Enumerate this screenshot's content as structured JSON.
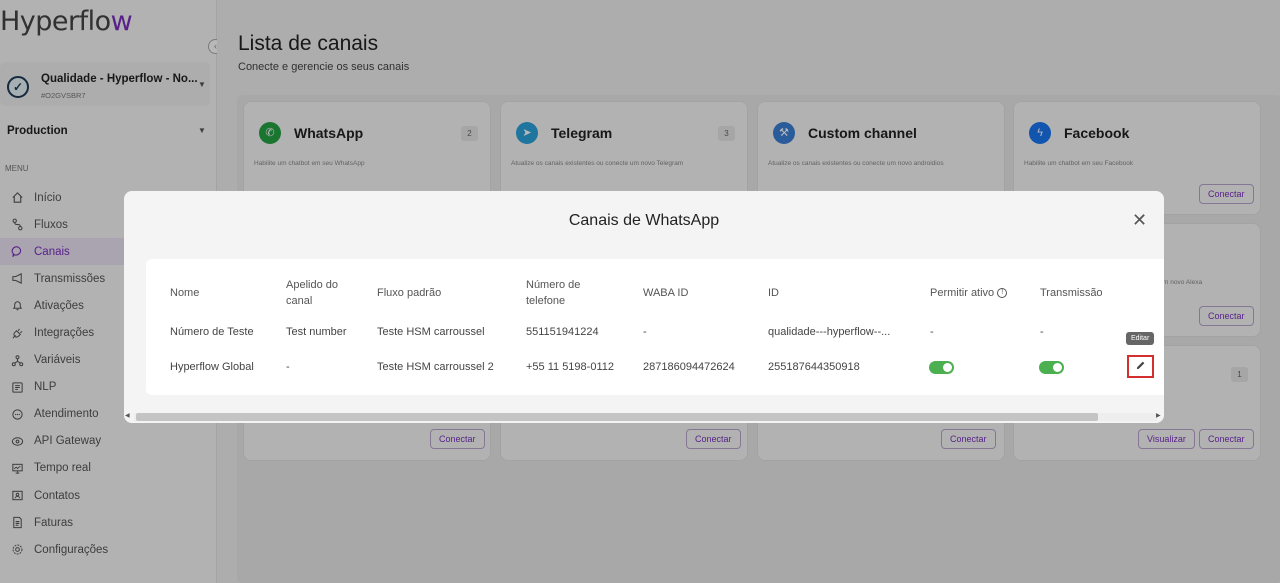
{
  "app": {
    "logo_text": "Hyperflow"
  },
  "sidebar": {
    "org_name": "Qualidade - Hyperflow - No...",
    "org_id": "#O2GVSBR7",
    "environment": "Production",
    "menu_header": "MENU",
    "items": [
      {
        "label": "Início",
        "icon": "home-icon"
      },
      {
        "label": "Fluxos",
        "icon": "flow-icon"
      },
      {
        "label": "Canais",
        "icon": "chat-icon",
        "active": true
      },
      {
        "label": "Transmissões",
        "icon": "megaphone-icon"
      },
      {
        "label": "Ativações",
        "icon": "bell-icon"
      },
      {
        "label": "Integrações",
        "icon": "plug-icon"
      },
      {
        "label": "Variáveis",
        "icon": "variables-icon"
      },
      {
        "label": "NLP",
        "icon": "nlp-icon"
      },
      {
        "label": "Atendimento",
        "icon": "support-icon"
      },
      {
        "label": "API Gateway",
        "icon": "gateway-icon"
      },
      {
        "label": "Tempo real",
        "icon": "monitor-icon"
      },
      {
        "label": "Contatos",
        "icon": "contacts-icon"
      },
      {
        "label": "Faturas",
        "icon": "invoice-icon"
      },
      {
        "label": "Configurações",
        "icon": "gear-icon"
      }
    ]
  },
  "page": {
    "title": "Lista de canais",
    "subtitle": "Conecte e gerencie os seus canais"
  },
  "cards": {
    "whatsapp": {
      "title": "WhatsApp",
      "count": "2",
      "desc": "Habilite um chatbot em seu WhatsApp",
      "connect": "Conectar"
    },
    "telegram": {
      "title": "Telegram",
      "count": "3",
      "desc": "Atualize os canais existentes ou conecte um novo Telegram",
      "connect": "Conectar"
    },
    "custom": {
      "title": "Custom channel",
      "desc": "Atualize os canais existentes ou conecte um novo androidios",
      "connect": "Conectar"
    },
    "facebook": {
      "title": "Facebook",
      "desc": "Habilite um chatbot em seu Facebook",
      "connect": "Conectar"
    },
    "alexa": {
      "desc_fragment": "e um novo Alexa",
      "connect": "Conectar"
    },
    "fifth": {
      "count": "1",
      "view": "Visualizar",
      "connect": "Conectar"
    }
  },
  "modal": {
    "title": "Canais de WhatsApp",
    "columns": {
      "nome": "Nome",
      "apelido": "Apelido do canal",
      "fluxo": "Fluxo padrão",
      "telefone": "Número de telefone",
      "waba": "WABA ID",
      "id": "ID",
      "permitir": "Permitir ativo",
      "transmissao": "Transmissão"
    },
    "rows": [
      {
        "nome": "Número de Teste",
        "apelido": "Test number",
        "fluxo": "Teste HSM carroussel",
        "telefone": "551151941224",
        "waba": "-",
        "id": "qualidade---hyperflow--...",
        "permitir": "-",
        "transmissao": "-"
      },
      {
        "nome": "Hyperflow Global",
        "apelido": "-",
        "fluxo": "Teste HSM carroussel 2",
        "telefone": "+55 11 5198-0112",
        "waba": "287186094472624",
        "id": "255187644350918",
        "permitir": true,
        "transmissao": true
      }
    ],
    "tooltip": "Editar",
    "toggle_color": "#4caf50"
  },
  "colors": {
    "accent": "#7b2fbe",
    "whatsapp": "#25a244",
    "telegram": "#2aa3dc",
    "facebook": "#1877f2",
    "edit_highlight": "#d32f2f"
  }
}
